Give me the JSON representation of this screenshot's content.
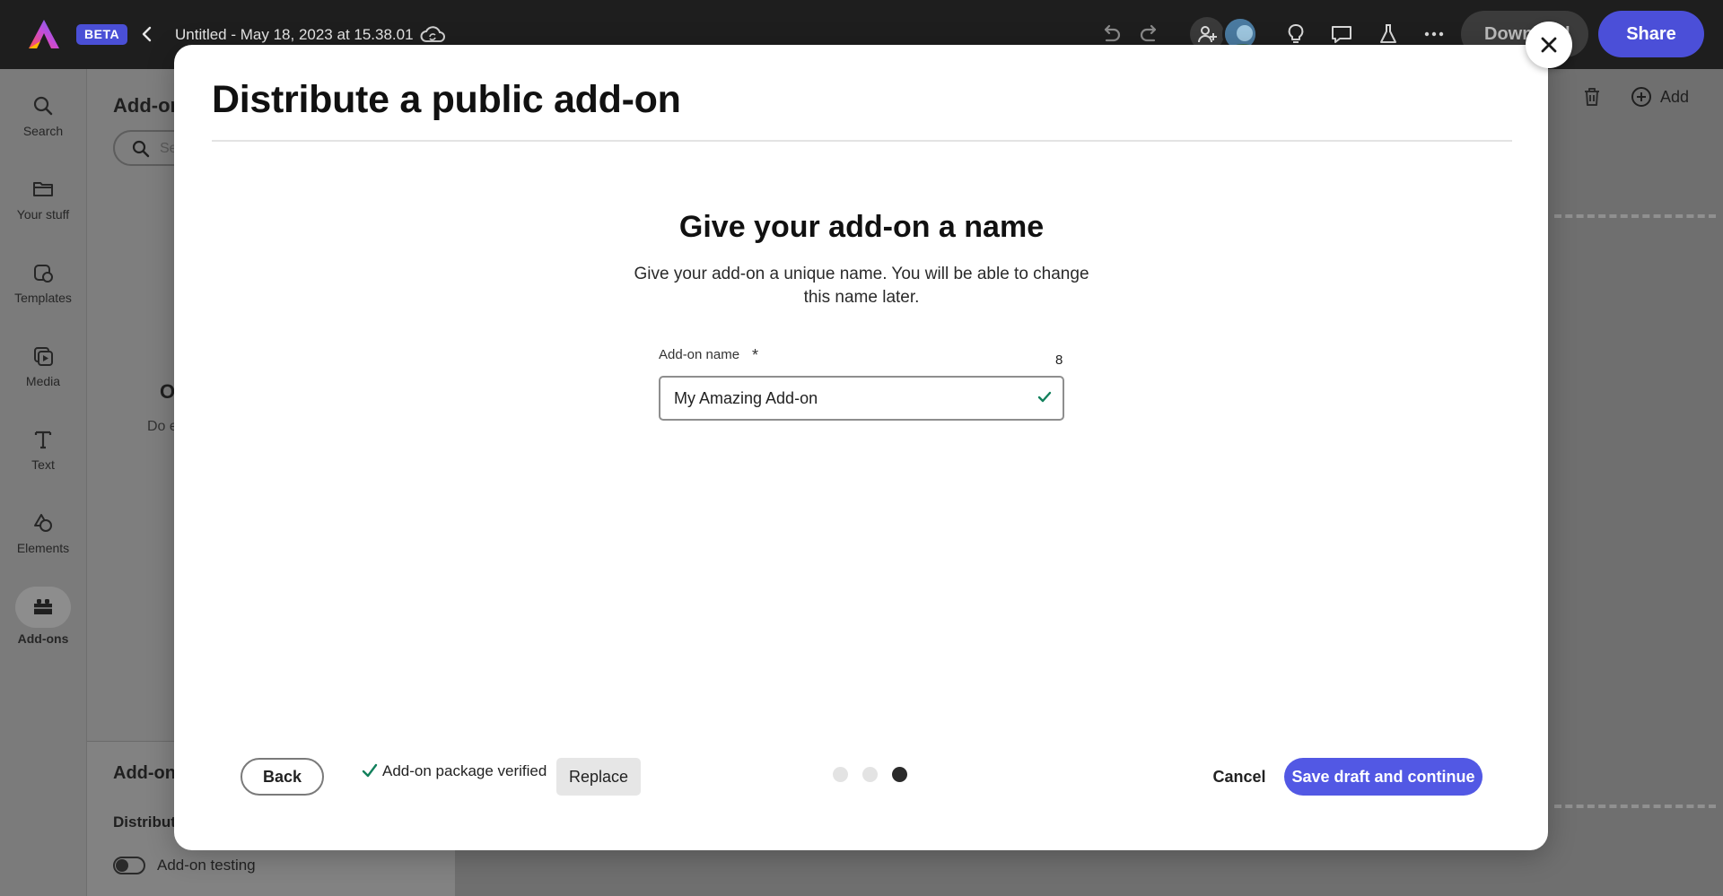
{
  "topbar": {
    "beta_label": "BETA",
    "document_title": "Untitled - May 18, 2023 at 15.38.01",
    "download_label": "Download",
    "share_label": "Share",
    "colors": {
      "background": "#1e1e1e",
      "accent": "#4b4fd8"
    }
  },
  "rail": {
    "items": [
      {
        "label": "Search",
        "icon": "search-icon"
      },
      {
        "label": "Your stuff",
        "icon": "folder-icon"
      },
      {
        "label": "Templates",
        "icon": "templates-icon"
      },
      {
        "label": "Media",
        "icon": "media-icon"
      },
      {
        "label": "Text",
        "icon": "text-icon"
      },
      {
        "label": "Elements",
        "icon": "elements-icon"
      },
      {
        "label": "Add-ons",
        "icon": "addons-icon",
        "active": true
      }
    ]
  },
  "panel": {
    "title": "Add-ons",
    "search_placeholder": "Search",
    "empty_heading": "O",
    "empty_text": "Do e",
    "bottom_title": "Add-on",
    "distribute_label": "Distribute",
    "toggle_label": "Add-on testing"
  },
  "canvas_toolbar": {
    "add_label": "Add"
  },
  "modal": {
    "title": "Distribute a public add-on",
    "step": {
      "title": "Give your add-on a name",
      "description": "Give your add-on a unique name. You will be able to change this name later."
    },
    "field": {
      "label": "Add-on name",
      "required_mark": "*",
      "char_count": "8",
      "value": "My Amazing Add-on",
      "valid": true
    },
    "footer": {
      "back_label": "Back",
      "verified_text": "Add-on package verified",
      "replace_label": "Replace",
      "steps_total": 3,
      "current_step": 3,
      "cancel_label": "Cancel",
      "save_label": "Save draft and continue"
    },
    "colors": {
      "primary": "#5258e4",
      "success": "#12805c"
    }
  }
}
